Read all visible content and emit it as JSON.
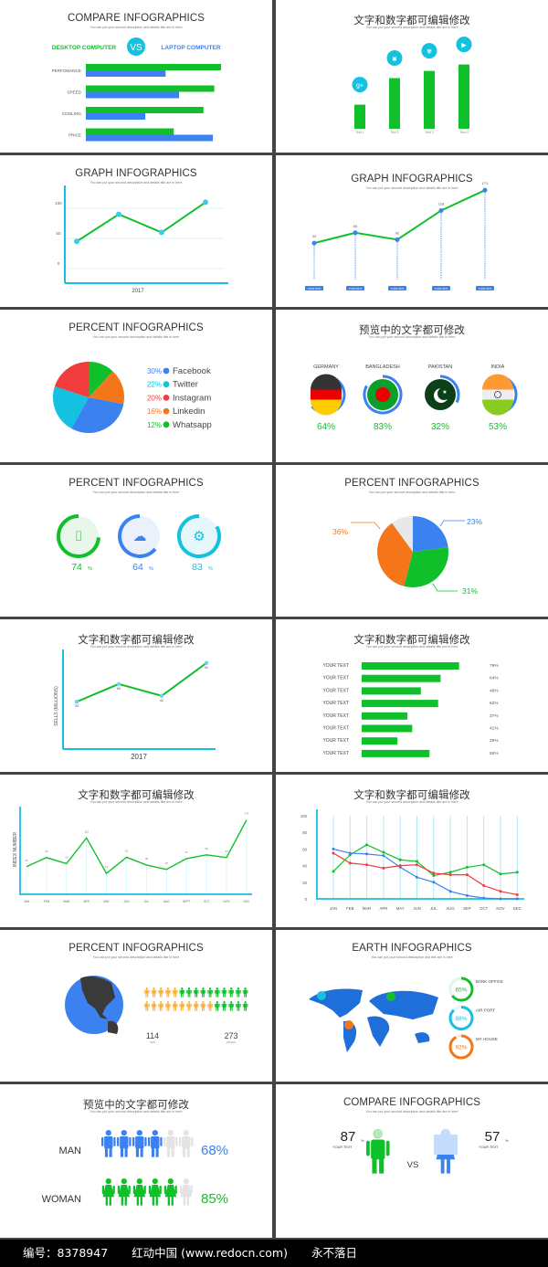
{
  "subtitle_default": "You can put your second description and details title are in here",
  "subtitle_percent": "You can put your second description and details title in here",
  "subtitle_earth": "You can  put your second description and title are in here",
  "colors": {
    "green": "#10c02a",
    "blue": "#3b82f0",
    "cyan": "#14c1e1",
    "red": "#f03c3c",
    "orange": "#f5761a",
    "gray": "#e5e5e5",
    "lightcyan": "#b8ecf5"
  },
  "panels": {
    "p1": {
      "title": "COMPARE INFOGRAPHICS",
      "left_label": "DESKTOP COMPUTER",
      "vs": "VS",
      "right_label": "LAPTOP COMPUTER"
    },
    "p2": {
      "title": "文字和数字都可编辑修改",
      "icons": [
        "google-plus-icon",
        "instagram-icon",
        "vimeo-icon",
        "youtube-icon"
      ]
    },
    "p3": {
      "title": "GRAPH INFOGRAPHICS"
    },
    "p4": {
      "title": "GRAPH INFOGRAPHICS"
    },
    "p5": {
      "title": "PERCENT INFOGRAPHICS"
    },
    "p6": {
      "title": "预览中的文字都可修改"
    },
    "p7": {
      "title": "PERCENT INFOGRAPHICS"
    },
    "p8": {
      "title": "PERCENT INFOGRAPHICS"
    },
    "p9": {
      "title": "文字和数字都可编辑修改"
    },
    "p10": {
      "title": "文字和数字都可编辑修改"
    },
    "p11": {
      "title": "文字和数字都可编辑修改"
    },
    "p12": {
      "title": "文字和数字都可编辑修改"
    },
    "p13": {
      "title": "PERCENT INFOGRAPHICS"
    },
    "p14": {
      "title": "EARTH INFOGRAPHICS"
    },
    "p15": {
      "title": "预览中的文字都可修改"
    },
    "p16": {
      "title": "COMPARE INFOGRAPHICS"
    }
  },
  "chart_data": [
    {
      "id": "compare-bars",
      "type": "bar",
      "orientation": "horizontal",
      "categories": [
        "PERFOMANCE",
        "SPEED",
        "COOLING",
        "PRICE"
      ],
      "series": [
        {
          "name": "DESKTOP COMPUTER",
          "values": [
            100,
            95,
            87,
            65
          ]
        },
        {
          "name": "LAPTOP COMPUTER",
          "values": [
            59,
            69,
            44,
            94
          ]
        }
      ],
      "xlim": [
        0,
        100
      ]
    },
    {
      "id": "social-bars",
      "type": "bar",
      "categories": [
        "Text 1",
        "Text 2",
        "Text 3",
        "Text 4"
      ],
      "values": [
        30,
        63,
        72,
        80
      ],
      "ylim": [
        0,
        100
      ]
    },
    {
      "id": "graph-2017",
      "type": "line",
      "x": [
        1,
        2,
        3,
        4
      ],
      "values": [
        45,
        90,
        60,
        110
      ],
      "yticks": [
        0,
        50,
        100
      ],
      "ylim": [
        -25,
        150
      ],
      "xlabel": "2017"
    },
    {
      "id": "graph-dotted",
      "type": "line",
      "categories": [
        "YOUR TEXT",
        "YOUR TEXT",
        "YOUR TEXT",
        "YOUR TEXT",
        "YOUR TEXT"
      ],
      "values": [
        33,
        60,
        42,
        118,
        171
      ],
      "labels": [
        "33",
        "60",
        "42",
        "118",
        "171"
      ]
    },
    {
      "id": "social-pie",
      "type": "pie",
      "categories": [
        "Facebook",
        "Twitter",
        "Instagram",
        "Linkedin",
        "Whatsapp"
      ],
      "values": [
        30,
        22,
        20,
        16,
        12
      ],
      "labels": [
        "30%",
        "22%",
        "20%",
        "16%",
        "12%"
      ]
    },
    {
      "id": "country-rings",
      "type": "pie",
      "categories": [
        "GERMANY",
        "BANGLADESH",
        "PAKISTAN",
        "INDIA"
      ],
      "values": [
        64,
        83,
        32,
        53
      ],
      "labels": [
        "64%",
        "83%",
        "32%",
        "53%"
      ]
    },
    {
      "id": "icon-rings",
      "type": "pie",
      "categories": [
        "camera",
        "cloud",
        "settings"
      ],
      "values": [
        74,
        64,
        83
      ],
      "labels": [
        "74",
        "64",
        "83"
      ],
      "unit": "%"
    },
    {
      "id": "callout-pie",
      "type": "pie",
      "categories": [
        "blue",
        "green",
        "orange",
        "gray"
      ],
      "values": [
        23,
        31,
        36,
        10
      ],
      "labels": [
        "23%",
        "31%",
        "36%",
        ""
      ]
    },
    {
      "id": "sells-2017",
      "type": "line",
      "values": [
        33,
        60,
        42,
        92
      ],
      "labels": [
        "33",
        "60",
        "42",
        "92"
      ],
      "ylabel": "SELLS (MILLIONS)",
      "xlabel": "2017"
    },
    {
      "id": "your-text-bars",
      "type": "bar",
      "orientation": "horizontal",
      "categories": [
        "YOUR TEXT",
        "YOUR TEXT",
        "YOUR TEXT",
        "YOUR TEXT",
        "YOUR TEXT",
        "YOUR TEXT",
        "YOUR TEXT",
        "YOUR TEXT"
      ],
      "values": [
        79,
        64,
        48,
        62,
        37,
        41,
        29,
        55
      ],
      "labels": [
        "79%",
        "64%",
        "48%",
        "62%",
        "37%",
        "41%",
        "29%",
        "55%"
      ]
    },
    {
      "id": "index-monthly",
      "type": "line",
      "categories": [
        "JAN",
        "FEB",
        "MAR",
        "APR",
        "MAY",
        "JUN",
        "JUL",
        "AUG",
        "SEPT",
        "OCT",
        "NOV",
        "DEC"
      ],
      "values": [
        33,
        60,
        42,
        118,
        13,
        61,
        38,
        25,
        57,
        68,
        60,
        171
      ],
      "ylabel": "INDEX NUMBER",
      "ylim": [
        -60,
        200
      ]
    },
    {
      "id": "three-lines",
      "type": "line",
      "categories": [
        "JAN",
        "FEB",
        "MAR",
        "APR",
        "MAY",
        "JUN",
        "JUL",
        "AUG",
        "SEP",
        "OCT",
        "NOV",
        "DEC"
      ],
      "yticks": [
        0,
        20,
        40,
        60,
        80,
        100
      ],
      "ylim": [
        0,
        100
      ],
      "series": [
        {
          "name": "green",
          "values": [
            33,
            53,
            65,
            56,
            47,
            45,
            28,
            32,
            38,
            41,
            30,
            32
          ]
        },
        {
          "name": "blue",
          "values": [
            60,
            55,
            54,
            52,
            38,
            26,
            20,
            9,
            4,
            1,
            0,
            0
          ]
        },
        {
          "name": "red",
          "values": [
            55,
            43,
            41,
            37,
            40,
            41,
            31,
            29,
            29,
            16,
            9,
            5
          ]
        }
      ]
    },
    {
      "id": "people-count",
      "type": "table",
      "man": 114,
      "woman": 273,
      "man_label": "MAN",
      "woman_label": "WOMAN",
      "man_icons": 15,
      "woman_icons": 15
    },
    {
      "id": "earth-rings",
      "type": "pie",
      "categories": [
        "BANK OFFICE",
        "AIR PORT",
        "MY HOUSE"
      ],
      "values": [
        65,
        88,
        92
      ],
      "labels": [
        "65%",
        "88%",
        "92%"
      ]
    },
    {
      "id": "gender-icons",
      "type": "bar",
      "categories": [
        "MAN",
        "WOMAN"
      ],
      "values": [
        68,
        85
      ],
      "labels": [
        "68%",
        "85%"
      ],
      "icons_total": 6,
      "icons_filled": [
        4,
        5
      ]
    },
    {
      "id": "gender-compare",
      "type": "bar",
      "categories": [
        "YOUR TEXT",
        "YOUR TEXT"
      ],
      "values": [
        87,
        57
      ],
      "unit": "%",
      "vs": "VS"
    }
  ],
  "footer": {
    "id": "编号：8378947",
    "site": "红动中国 (www.redocn.com)",
    "slogan": "永不落日"
  }
}
